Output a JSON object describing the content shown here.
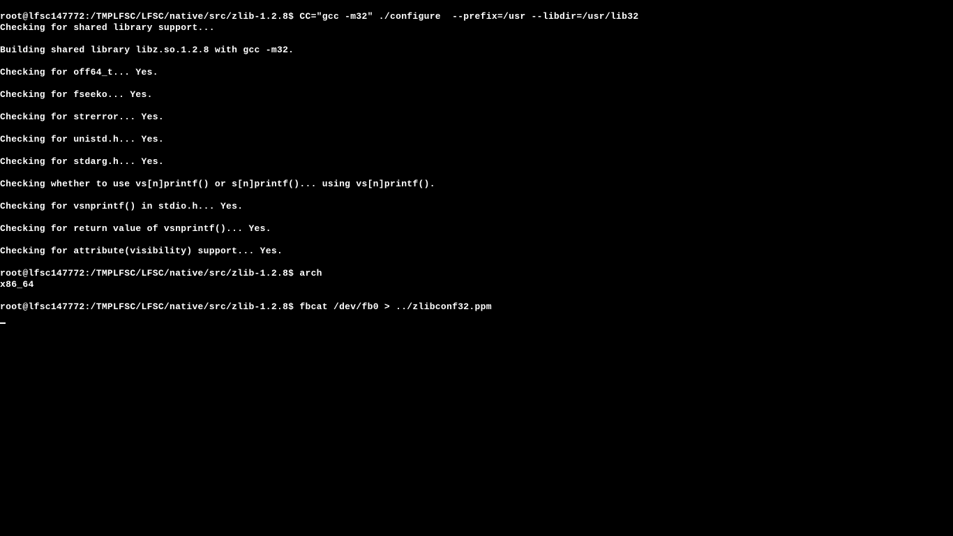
{
  "terminal": {
    "prompt": "root@lfsc147772:/TMPLFSC/LFSC/native/src/zlib-1.2.8$",
    "commands": {
      "cmd1": "CC=\"gcc -m32\" ./configure  --prefix=/usr --libdir=/usr/lib32",
      "cmd2": "arch",
      "cmd3": "fbcat /dev/fb0 > ../zlibconf32.ppm"
    },
    "output": {
      "line1": "Checking for shared library support...",
      "line2": "Building shared library libz.so.1.2.8 with gcc -m32.",
      "line3": "Checking for off64_t... Yes.",
      "line4": "Checking for fseeko... Yes.",
      "line5": "Checking for strerror... Yes.",
      "line6": "Checking for unistd.h... Yes.",
      "line7": "Checking for stdarg.h... Yes.",
      "line8": "Checking whether to use vs[n]printf() or s[n]printf()... using vs[n]printf().",
      "line9": "Checking for vsnprintf() in stdio.h... Yes.",
      "line10": "Checking for return value of vsnprintf()... Yes.",
      "line11": "Checking for attribute(visibility) support... Yes.",
      "arch_output": "x86_64"
    }
  }
}
